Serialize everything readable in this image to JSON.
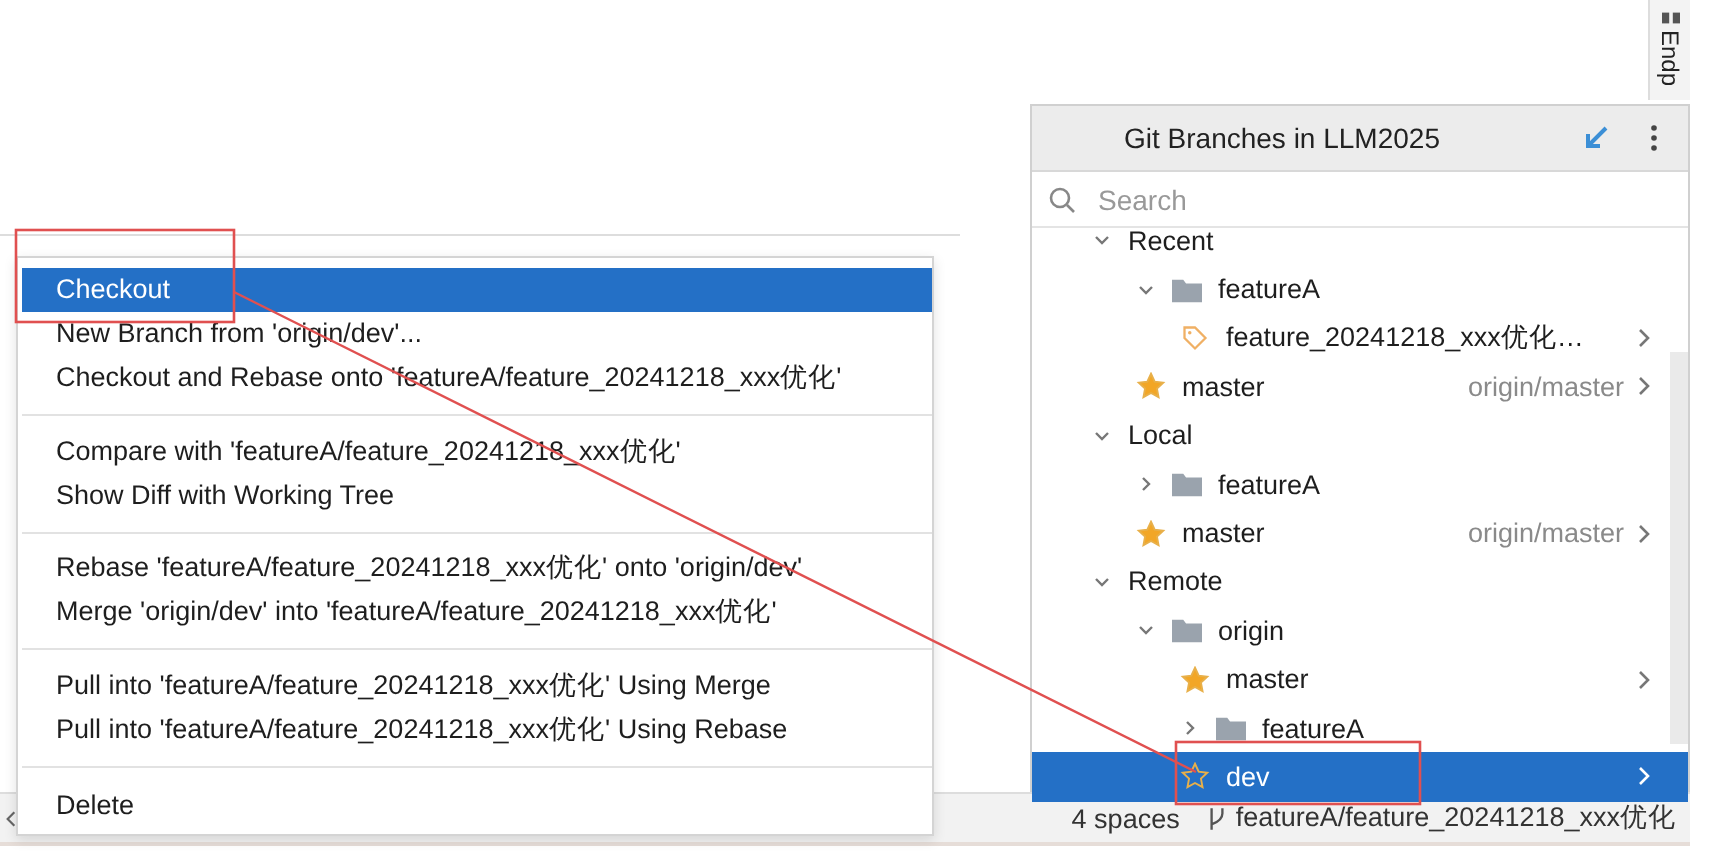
{
  "side_tab": {
    "label": "Endp"
  },
  "context_menu": {
    "groups": [
      {
        "items": [
          {
            "label": "Checkout",
            "selected": true
          },
          {
            "label": "New Branch from 'origin/dev'...",
            "selected": false
          },
          {
            "label": "Checkout and Rebase onto 'featureA/feature_20241218_xxx优化'",
            "selected": false
          }
        ]
      },
      {
        "items": [
          {
            "label": "Compare with 'featureA/feature_20241218_xxx优化'",
            "selected": false
          },
          {
            "label": "Show Diff with Working Tree",
            "selected": false
          }
        ]
      },
      {
        "items": [
          {
            "label": "Rebase 'featureA/feature_20241218_xxx优化' onto 'origin/dev'",
            "selected": false
          },
          {
            "label": "Merge 'origin/dev' into 'featureA/feature_20241218_xxx优化'",
            "selected": false
          }
        ]
      },
      {
        "items": [
          {
            "label": "Pull into 'featureA/feature_20241218_xxx优化' Using Merge",
            "selected": false
          },
          {
            "label": "Pull into 'featureA/feature_20241218_xxx优化' Using Rebase",
            "selected": false
          }
        ]
      },
      {
        "items": [
          {
            "label": "Delete",
            "selected": false
          }
        ]
      }
    ]
  },
  "branches_popup": {
    "title": "Git Branches in LLM2025",
    "search": {
      "placeholder": "Search"
    },
    "tree": [
      {
        "kind": "section",
        "label": "Recent",
        "expanded": true,
        "children": [
          {
            "kind": "folder",
            "label": "featureA",
            "expanded": true,
            "children": [
              {
                "kind": "current-branch",
                "label": "feature_20241218_xxx优化…",
                "selected": false
              }
            ]
          },
          {
            "kind": "branch",
            "label": "master",
            "favorite": true,
            "tracking": "origin/master",
            "selected": false
          }
        ]
      },
      {
        "kind": "section",
        "label": "Local",
        "expanded": true,
        "children": [
          {
            "kind": "folder",
            "label": "featureA",
            "expanded": false
          },
          {
            "kind": "branch",
            "label": "master",
            "favorite": true,
            "tracking": "origin/master",
            "selected": false
          }
        ]
      },
      {
        "kind": "section",
        "label": "Remote",
        "expanded": true,
        "children": [
          {
            "kind": "folder",
            "label": "origin",
            "expanded": true,
            "children": [
              {
                "kind": "branch",
                "label": "master",
                "favorite": true,
                "selected": false
              },
              {
                "kind": "folder",
                "label": "featureA",
                "expanded": false
              },
              {
                "kind": "branch",
                "label": "dev",
                "favorite": false,
                "selected": true
              }
            ]
          }
        ]
      }
    ]
  },
  "status_bar": {
    "indent": "4 spaces",
    "branch": "featureA/feature_20241218_xxx优化"
  }
}
